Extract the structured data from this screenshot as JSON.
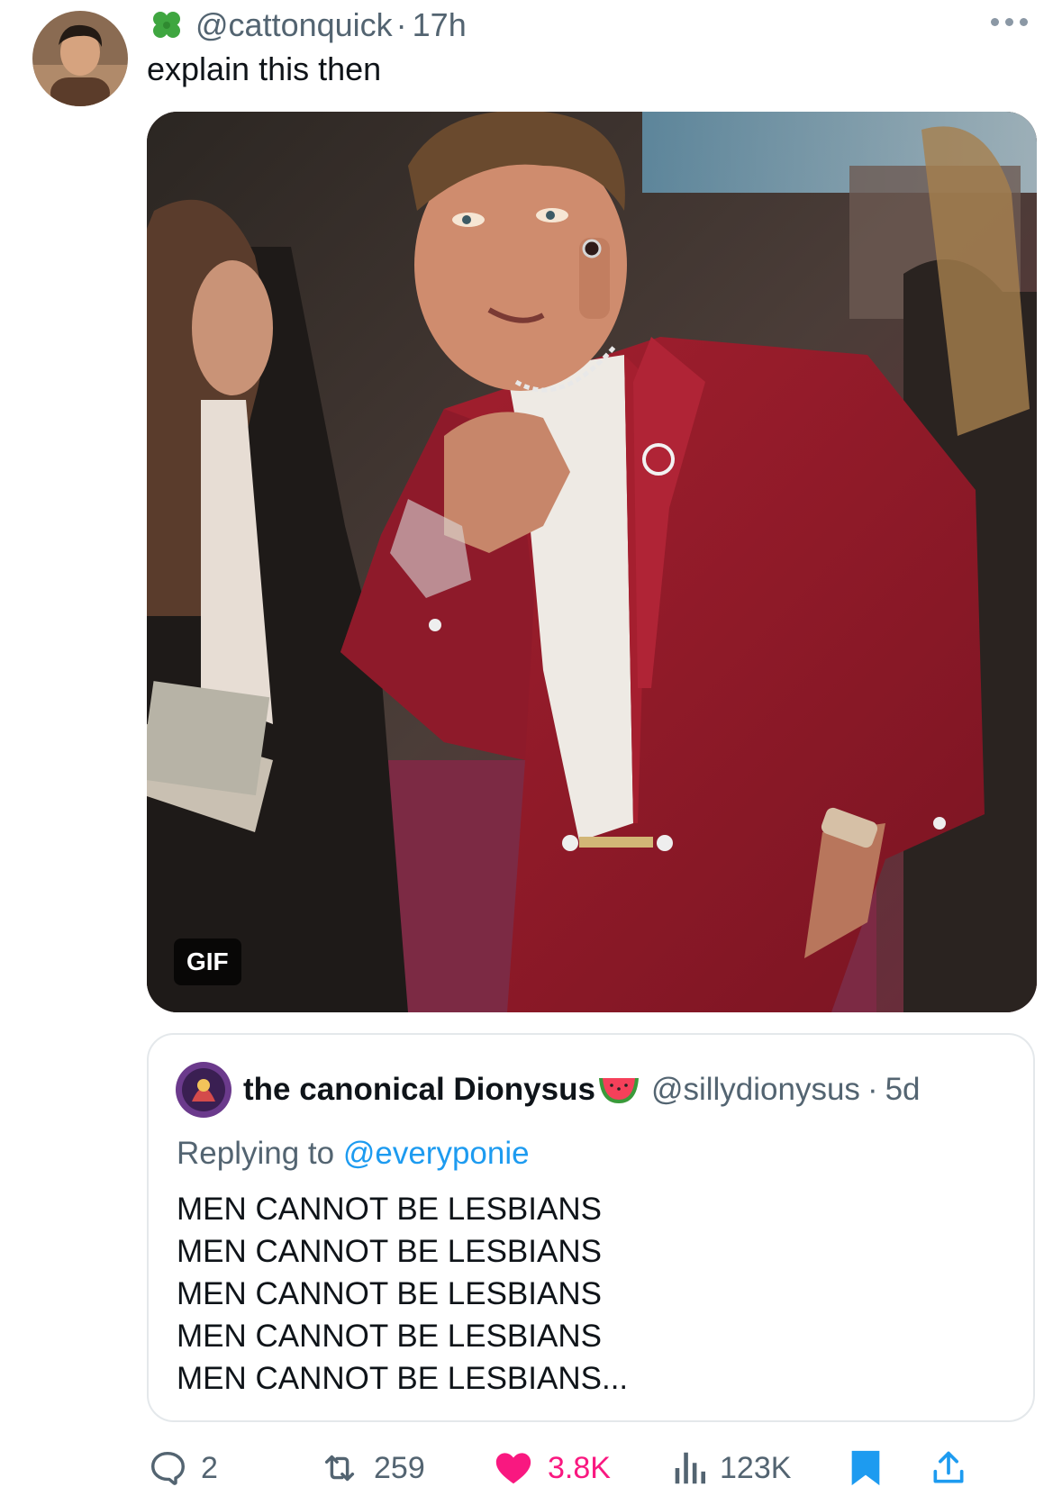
{
  "tweet": {
    "handle": "@cattonquick",
    "separator": "·",
    "time": "17h",
    "text": "explain this then",
    "media_badge": "GIF"
  },
  "quote": {
    "name": "the canonical Dionysus",
    "handle": "@sillydionysus",
    "separator": "·",
    "time": "5d",
    "replying_prefix": "Replying to",
    "replying_to": "@everyponie",
    "lines": [
      "MEN CANNOT BE LESBIANS",
      "MEN CANNOT BE LESBIANS",
      "MEN CANNOT BE LESBIANS",
      "MEN CANNOT BE LESBIANS",
      "MEN CANNOT BE LESBIANS..."
    ]
  },
  "actions": {
    "replies": "2",
    "retweets": "259",
    "likes": "3.8K",
    "views": "123K"
  },
  "colors": {
    "accent": "#1d9bf0",
    "like": "#f91880",
    "muted": "#536471",
    "suit": "#8e1a2a"
  }
}
